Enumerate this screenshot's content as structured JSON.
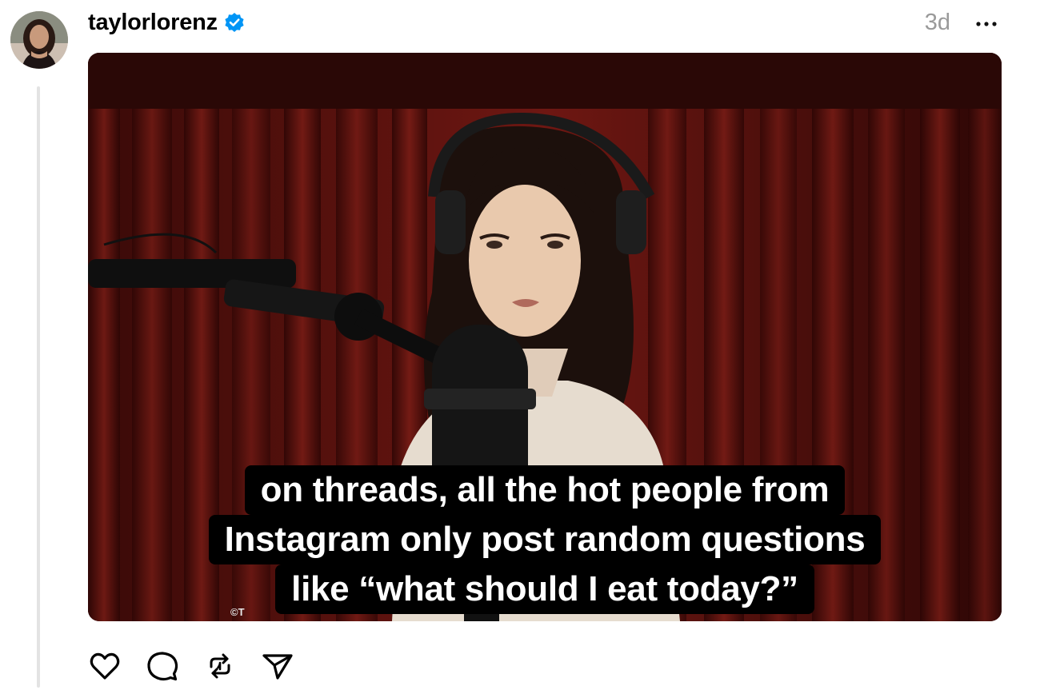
{
  "post": {
    "author": {
      "username": "taylorlorenz",
      "verified": true,
      "avatar": "profile-photo"
    },
    "timestamp": "3d",
    "menu_icon": "more-horizontal-icon",
    "media": {
      "type": "video-still",
      "caption_lines": [
        "on threads, all the hot people from",
        "Instagram only post random questions",
        "like “what should I eat today?”"
      ],
      "watermark": "©T"
    },
    "actions": [
      {
        "name": "like",
        "icon": "heart-icon"
      },
      {
        "name": "reply",
        "icon": "comment-icon"
      },
      {
        "name": "repost",
        "icon": "repost-icon"
      },
      {
        "name": "share",
        "icon": "send-icon"
      }
    ]
  },
  "colors": {
    "verified_badge": "#0095f6",
    "timestamp": "#9a9a9a",
    "thread_line": "#e3e3e3"
  }
}
